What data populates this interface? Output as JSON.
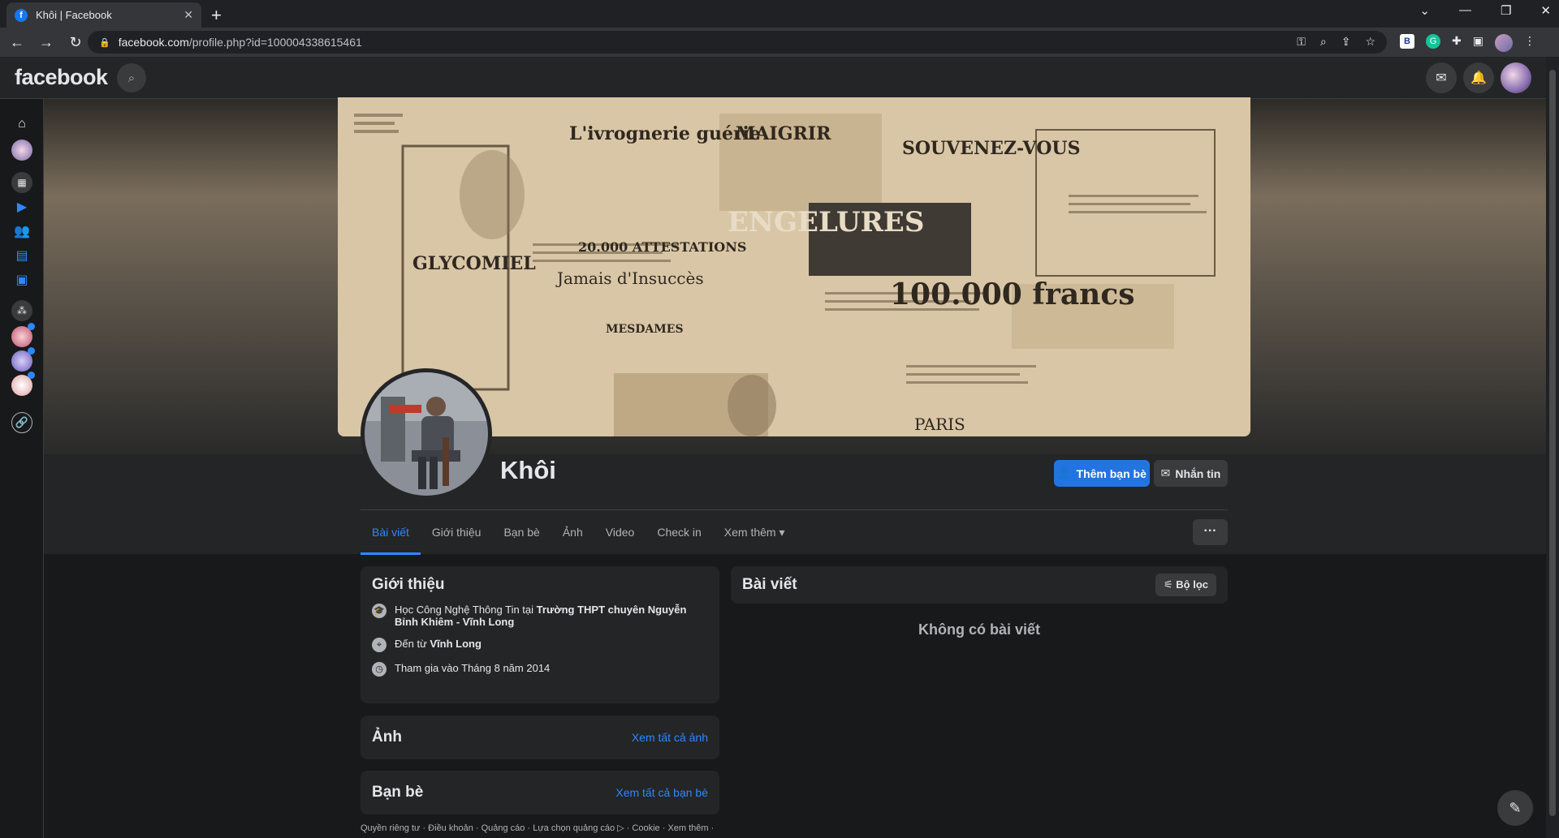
{
  "browser": {
    "tab_title": "Khôi | Facebook",
    "tab_close": "✕",
    "new_tab": "+",
    "url_host": "facebook.com",
    "url_path": "/profile.php?id=100004338615461",
    "window_buttons": [
      "⌄",
      "—",
      "❐",
      "✕"
    ]
  },
  "facebook": {
    "logo": "facebook",
    "profile": {
      "name": "Khôi",
      "add_friend_label": "Thêm bạn bè",
      "message_label": "Nhắn tin",
      "more_button": "···",
      "cover_texts": [
        "L'ivrognerie guérie",
        "MAIGRIR",
        "SOUVENEZ-VOUS",
        "ENGELURES",
        "GLYCOMIEL",
        "20.000 ATTESTATIONS",
        "Jamais d'Insuccès",
        "100.000 francs",
        "MESDAMES",
        "PARIS"
      ]
    },
    "tabs": [
      "Bài viết",
      "Giới thiệu",
      "Bạn bè",
      "Ảnh",
      "Video",
      "Check in",
      "Xem thêm ▾"
    ],
    "intro": {
      "title": "Giới thiệu",
      "study_prefix": "Học Công Nghệ Thông Tin tại ",
      "study_school": "Trường THPT chuyên Nguyễn Bỉnh Khiêm - Vĩnh Long",
      "from_prefix": "Đến từ ",
      "from_place": "Vĩnh Long",
      "joined": "Tham gia vào Tháng 8 năm 2014"
    },
    "photos": {
      "title": "Ảnh",
      "see_all": "Xem tất cả ảnh"
    },
    "friends": {
      "title": "Bạn bè",
      "see_all": "Xem tất cả bạn bè"
    },
    "posts": {
      "title": "Bài viết",
      "filter_label": "Bộ lọc",
      "empty": "Không có bài viết"
    },
    "footer": "Quyền riêng tư · Điều khoản · Quảng cáo · Lựa chọn quảng cáo ▷ · Cookie · Xem thêm ·"
  },
  "colors": {
    "accent": "#2d88ff",
    "button_primary": "#2374e1",
    "card": "#242526",
    "bg": "#18191a"
  },
  "icons": {
    "rail": [
      "home-icon",
      "profile-avatar",
      "apps-grid-icon",
      "watch-icon",
      "friends-icon",
      "marketplace-icon",
      "gaming-icon",
      "groups-icon",
      "shortcut-1",
      "shortcut-2",
      "shortcut-3",
      "link-icon"
    ]
  }
}
